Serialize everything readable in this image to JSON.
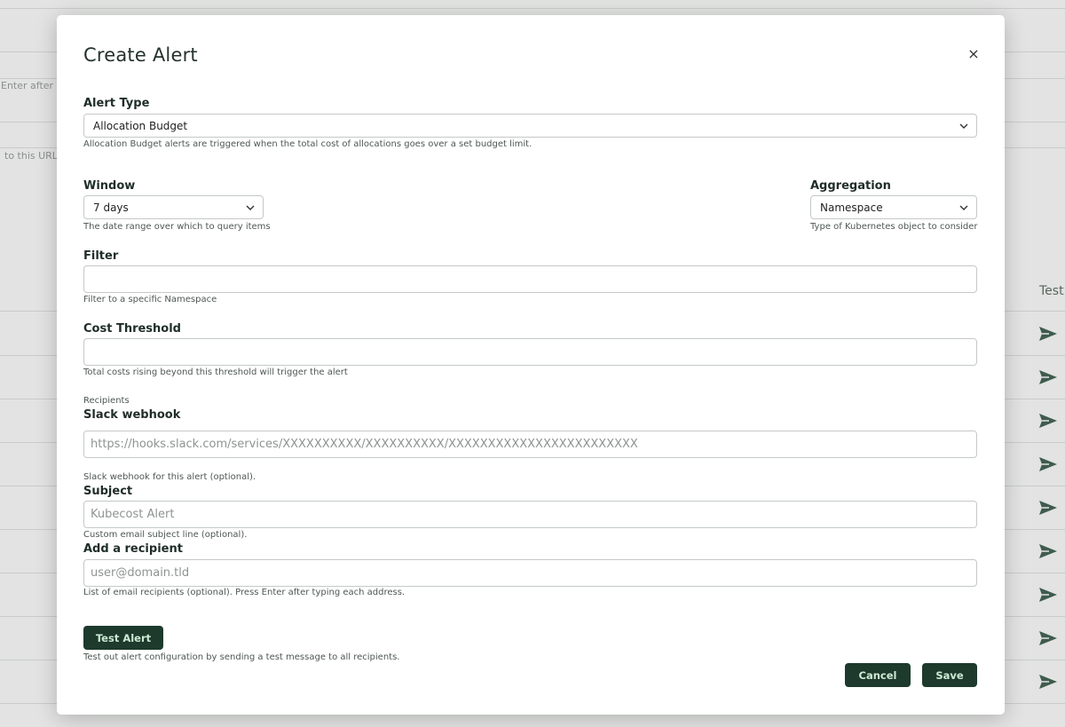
{
  "background": {
    "left_snippets": [
      "Enter after ty",
      "to this URL"
    ],
    "column_header": "Test",
    "bottom_text": "…",
    "send_icon": "send-arrow-icon"
  },
  "modal": {
    "title": "Create Alert",
    "close_icon": "×",
    "alert_type": {
      "label": "Alert Type",
      "selected": "Allocation Budget",
      "help": "Allocation Budget alerts are triggered when the total cost of allocations goes over a set budget limit."
    },
    "window": {
      "label": "Window",
      "selected": "7 days",
      "help": "The date range over which to query items"
    },
    "aggregation": {
      "label": "Aggregation",
      "selected": "Namespace",
      "help": "Type of Kubernetes object to consider"
    },
    "filter": {
      "label": "Filter",
      "value": "",
      "placeholder": "",
      "help": "Filter to a specific Namespace"
    },
    "cost_threshold": {
      "label": "Cost Threshold",
      "value": "",
      "placeholder": "",
      "help": "Total costs rising beyond this threshold will trigger the alert"
    },
    "recipients_label": "Recipients",
    "slack": {
      "label": "Slack webhook",
      "value": "",
      "placeholder": "https://hooks.slack.com/services/XXXXXXXXXX/XXXXXXXXXX/XXXXXXXXXXXXXXXXXXXXXXXX",
      "help": "Slack webhook for this alert (optional)."
    },
    "subject": {
      "label": "Subject",
      "value": "",
      "placeholder": "Kubecost Alert",
      "help": "Custom email subject line (optional)."
    },
    "recipient": {
      "label": "Add a recipient",
      "value": "",
      "placeholder": "user@domain.tld",
      "help": "List of email recipients (optional). Press Enter after typing each address."
    },
    "test_button": "Test Alert",
    "test_help": "Test out alert configuration by sending a test message to all recipients.",
    "cancel_button": "Cancel",
    "save_button": "Save"
  },
  "colors": {
    "primary_button_bg": "#1d3a2c",
    "primary_button_text": "#cfe9d4",
    "backdrop": "#e2e3e2"
  }
}
